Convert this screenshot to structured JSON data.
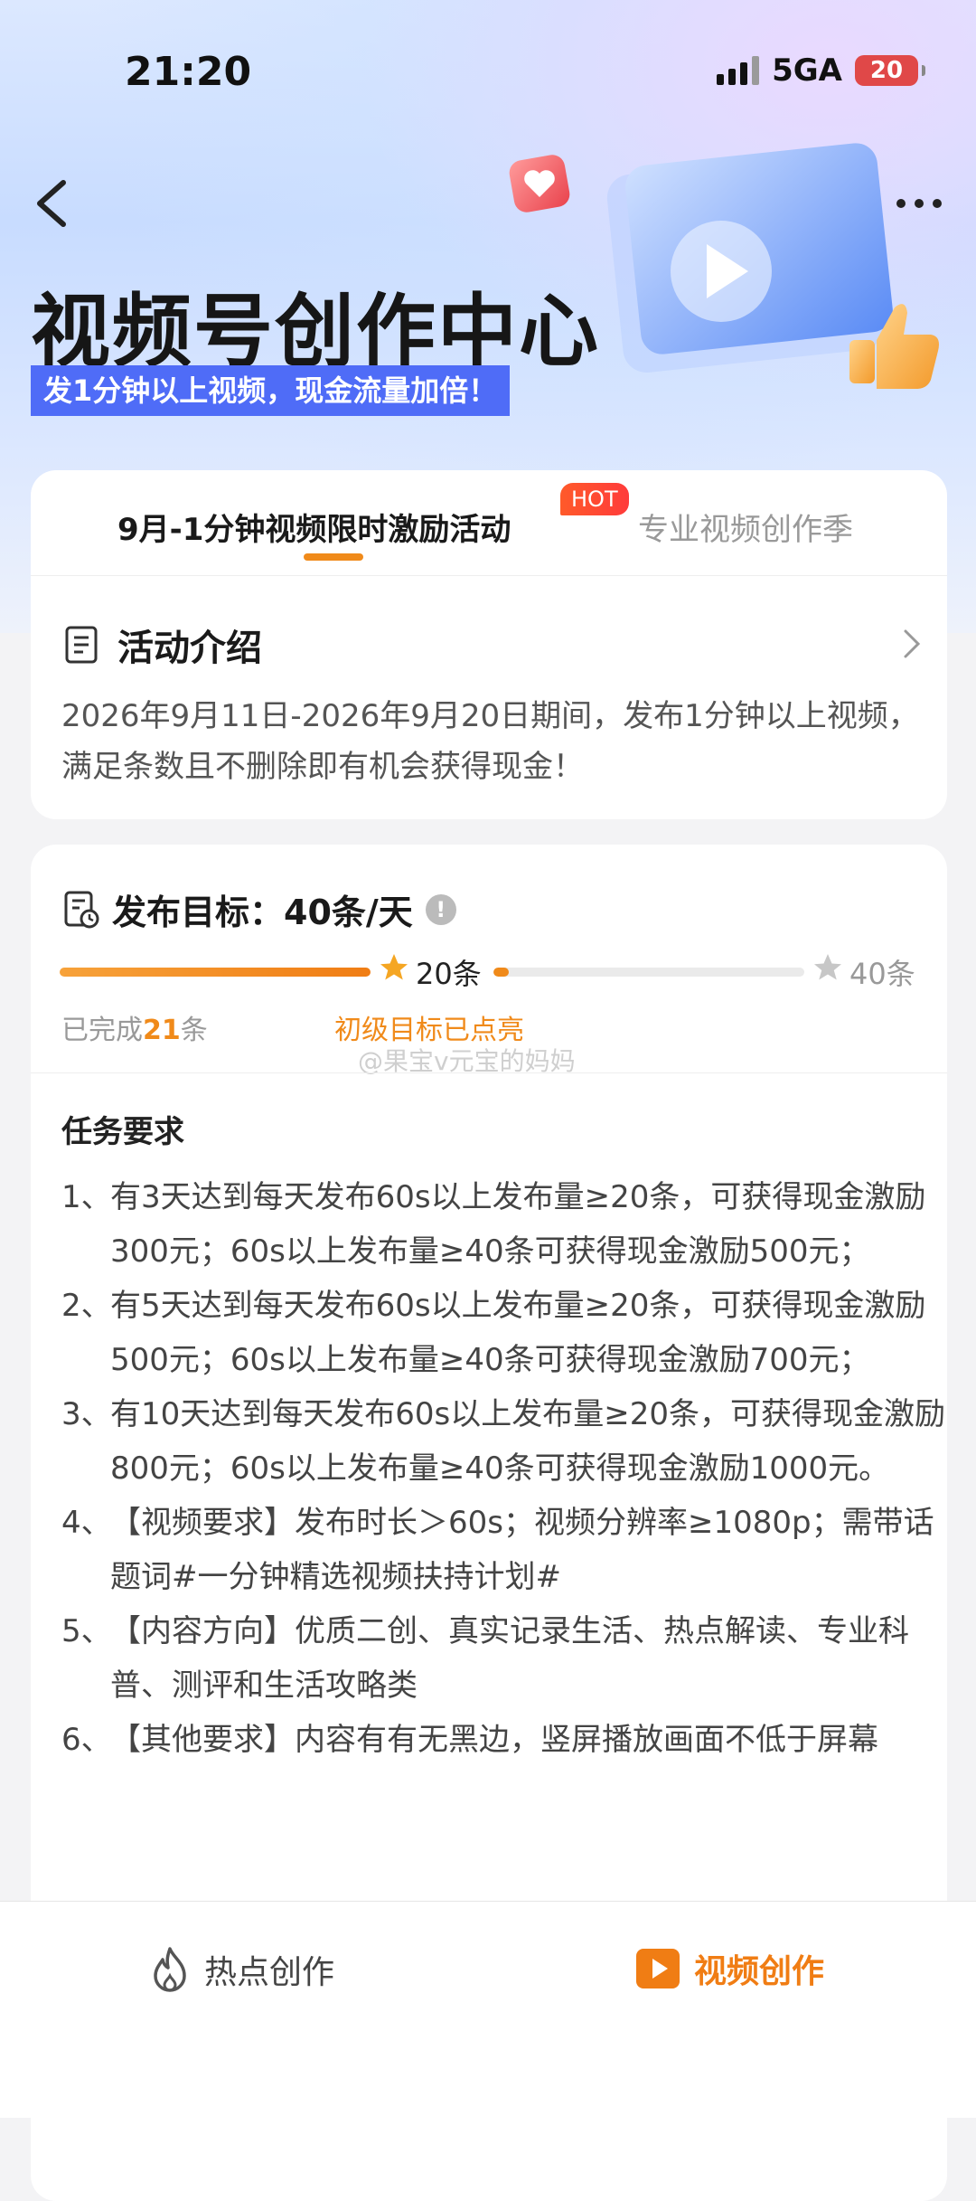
{
  "status": {
    "time": "21:20",
    "network": "5GA",
    "battery": "20"
  },
  "header": {
    "title": "视频号创作中心",
    "subtitle": "发1分钟以上视频，现金流量加倍！"
  },
  "tabs": [
    {
      "label": "9月-1分钟视频限时激励活动",
      "badge": "HOT",
      "active": true
    },
    {
      "label": "专业视频创作季",
      "active": false
    }
  ],
  "intro": {
    "title": "活动介绍",
    "text": "2026年9月11日-2026年9月20日期间，发布1分钟以上视频，满足条数且不删除即有机会获得现金！"
  },
  "goal": {
    "title": "发布目标：40条/天",
    "milestone1": "20条",
    "milestone2": "40条",
    "done_prefix": "已完成",
    "done_count": "21",
    "done_suffix": "条",
    "status": "初级目标已点亮",
    "progress_stage1": 1.0,
    "progress_stage2": 0.05
  },
  "watermark": "@果宝v元宝的妈妈",
  "requirements": {
    "title": "任务要求",
    "items": [
      {
        "num": "1、",
        "text": "有3天达到每天发布60s以上发布量≥20条，可获得现金激励300元；60s以上发布量≥40条可获得现金激励500元；"
      },
      {
        "num": "2、",
        "text": "有5天达到每天发布60s以上发布量≥20条，可获得现金激励500元；60s以上发布量≥40条可获得现金激励700元；"
      },
      {
        "num": "3、",
        "text": "有10天达到每天发布60s以上发布量≥20条，可获得现金激励800元；60s以上发布量≥40条可获得现金激励1000元。"
      },
      {
        "num": "4、",
        "text": "【视频要求】发布时长＞60s；视频分辨率≥1080p；需带话题词#一分钟精选视频扶持计划#"
      },
      {
        "num": "5、",
        "text": "【内容方向】优质二创、真实记录生活、热点解读、专业科普、测评和生活攻略类"
      },
      {
        "num": "6、",
        "text": "【其他要求】内容有有无黑边，竖屏播放画面不低于屏幕"
      }
    ]
  },
  "bottom_nav": {
    "hot": "热点创作",
    "video": "视频创作"
  },
  "colors": {
    "accent": "#f07d14",
    "brand_blue": "#4f6cf7"
  }
}
